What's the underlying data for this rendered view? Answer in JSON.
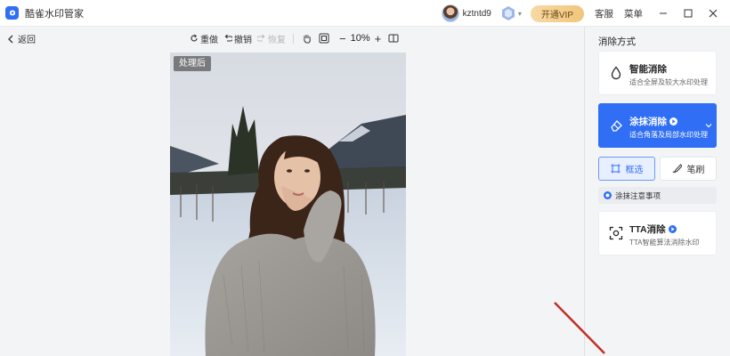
{
  "app": {
    "title": "酷雀水印管家",
    "username": "kztntd9",
    "vip_button": "开通VIP",
    "customer_service": "客服",
    "menu": "菜单"
  },
  "toolbar": {
    "back": "返回",
    "redo_all": "重做",
    "undo": "撤销",
    "restore": "恢复",
    "zoom_minus": "−",
    "zoom_value": "10%",
    "zoom_plus": "+"
  },
  "canvas": {
    "after_label": "处理后"
  },
  "panel": {
    "title": "消除方式",
    "smart": {
      "title": "智能消除",
      "subtitle": "适合全屏及较大水印处理"
    },
    "smear": {
      "title": "涂抹消除",
      "subtitle": "适合角落及局部水印处理"
    },
    "select_mode": "框选",
    "brush_mode": "笔刷",
    "notice": "涂抹注意事项",
    "tta": {
      "title": "TTA消除",
      "subtitle": "TTA智能算法消除水印"
    }
  },
  "colors": {
    "accent": "#2f6ef5",
    "vip_gold": "#f1c67c",
    "annotation_arrow": "#c0302a"
  }
}
